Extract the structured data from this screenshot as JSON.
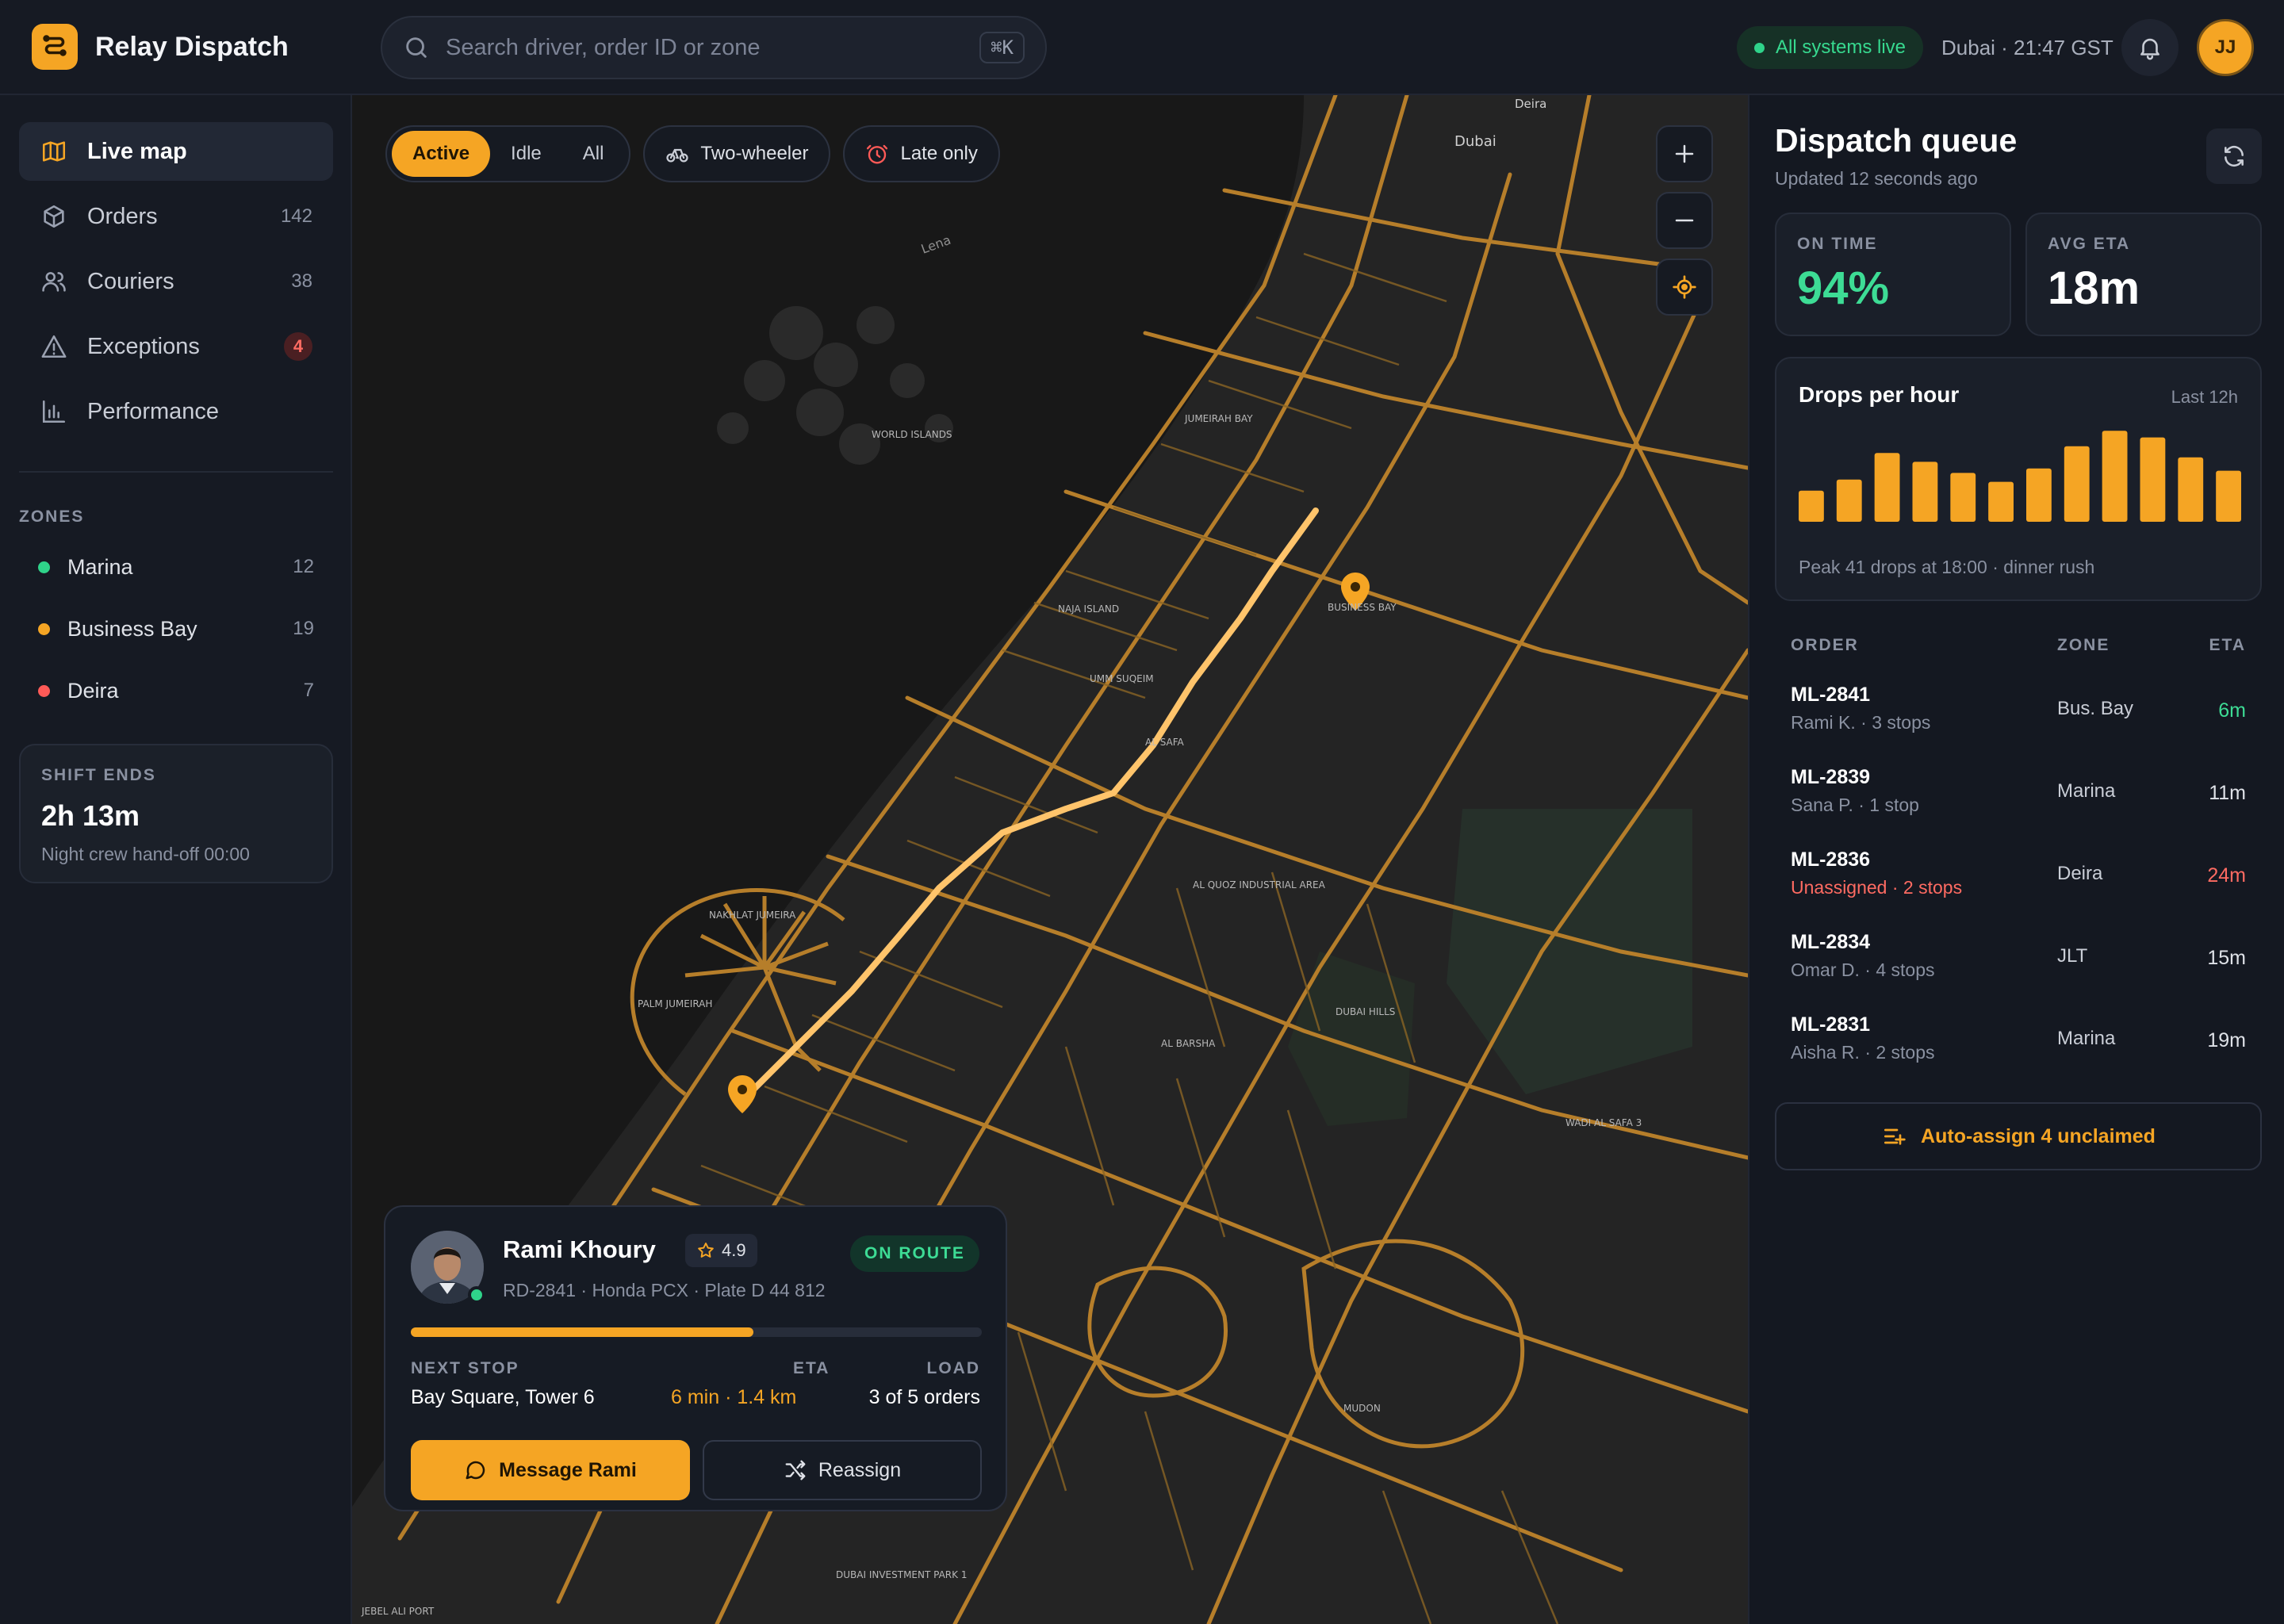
{
  "app": {
    "name": "Relay Dispatch",
    "search_placeholder": "Search driver, order ID or zone",
    "search_shortcut": "⌘K",
    "status_text": "All systems live",
    "locale_time": "Dubai · 21:47 GST",
    "user_initials": "JJ",
    "colors": {
      "accent": "#f5a524",
      "success": "#2fd38a",
      "danger": "#ff6b62"
    }
  },
  "sidebar": {
    "nav": [
      {
        "label": "Live map",
        "icon": "map-icon",
        "count": ""
      },
      {
        "label": "Orders",
        "icon": "box-icon",
        "count": "142"
      },
      {
        "label": "Couriers",
        "icon": "users-icon",
        "count": "38"
      },
      {
        "label": "Exceptions",
        "icon": "warning-icon",
        "count": "4"
      },
      {
        "label": "Performance",
        "icon": "bar-chart-icon",
        "count": ""
      }
    ],
    "zones_heading": "ZONES",
    "zones": [
      {
        "name": "Marina",
        "count": "12",
        "color": "#2fd38a"
      },
      {
        "name": "Business Bay",
        "count": "19",
        "color": "#f5a524"
      },
      {
        "name": "Deira",
        "count": "7",
        "color": "#ff5a57"
      }
    ],
    "shift": {
      "label": "SHIFT ENDS",
      "value": "2h 13m",
      "note": "Night crew hand-off 00:00"
    }
  },
  "map": {
    "filters": {
      "segments": [
        "Active",
        "Idle",
        "All"
      ],
      "selected": "Active"
    },
    "chip_two_wheeler": "Two-wheeler",
    "chip_late": "Late only",
    "labels": {
      "dubai": "Dubai",
      "deira": "Deira",
      "world_islands": "WORLD ISLANDS",
      "palm_jumeirah": "PALM JUMEIRAH",
      "nakhlat": "NAKHLAT JUMEIRA",
      "jumeirah_bay": "JUMEIRAH BAY",
      "naja_island": "NAJA ISLAND",
      "dubai_hills": "DUBAI HILLS",
      "al_barsha": "AL BARSHA",
      "al_quoz": "AL QUOZ INDUSTRIAL AREA",
      "business_bay": "BUSINESS BAY",
      "jebel_ali": "JEBEL ALI PORT",
      "umm_suqeim": "UMM SUQEIM",
      "al_safa": "AL SAFA",
      "wadi_al_safa": "WADI AL SAFA 3",
      "dubai_investment_park": "DUBAI INVESTMENT PARK 1",
      "mudon": "MUDON",
      "lena": "Lena"
    }
  },
  "driver": {
    "name": "Rami Khoury",
    "rating": "4.9",
    "meta": "RD-2841 · Honda PCX · Plate D 44 812",
    "status": "ON ROUTE",
    "progress": 0.6,
    "next_stop_label": "NEXT STOP",
    "next_stop": "Bay Square, Tower 6",
    "eta_label": "ETA",
    "eta": "6 min · 1.4 km",
    "load_label": "LOAD",
    "load": "3 of 5 orders",
    "message_label": "Message Rami",
    "reassign_label": "Reassign"
  },
  "panel": {
    "title": "Dispatch queue",
    "updated": "Updated 12 seconds ago",
    "kpis": [
      {
        "label": "ON TIME",
        "value": "94%",
        "color": "#3ddc95"
      },
      {
        "label": "AVG ETA",
        "value": "18m",
        "color": "#ffffff"
      }
    ],
    "chart_title": "Drops per hour",
    "chart_range": "Last 12h",
    "chart_note": "Peak 41 drops at 18:00 · dinner rush",
    "chart_data": {
      "type": "bar",
      "title": "Drops per hour",
      "values": [
        14,
        19,
        31,
        27,
        22,
        18,
        24,
        34,
        41,
        38,
        29,
        23
      ],
      "ylim": [
        0,
        45
      ],
      "grid": false,
      "legend": "none"
    },
    "table_headers": {
      "order": "ORDER",
      "zone": "ZONE",
      "eta": "ETA"
    },
    "orders": [
      {
        "id": "ML-2841",
        "sub": "Rami K. · 3 stops",
        "zone": "Bus. Bay",
        "eta": "6m",
        "eta_color": "#3ddc95",
        "sub_color": "#8a91a1"
      },
      {
        "id": "ML-2839",
        "sub": "Sana P. · 1 stop",
        "zone": "Marina",
        "eta": "11m",
        "eta_color": "#dfe2e8",
        "sub_color": "#8a91a1"
      },
      {
        "id": "ML-2836",
        "sub": "Unassigned · 2 stops",
        "zone": "Deira",
        "eta": "24m",
        "eta_color": "#ff6b62",
        "sub_color": "#ff6b62"
      },
      {
        "id": "ML-2834",
        "sub": "Omar D. · 4 stops",
        "zone": "JLT",
        "eta": "15m",
        "eta_color": "#dfe2e8",
        "sub_color": "#8a91a1"
      },
      {
        "id": "ML-2831",
        "sub": "Aisha R. · 2 stops",
        "zone": "Marina",
        "eta": "19m",
        "eta_color": "#dfe2e8",
        "sub_color": "#8a91a1"
      }
    ],
    "auto_assign": "Auto-assign 4 unclaimed"
  }
}
